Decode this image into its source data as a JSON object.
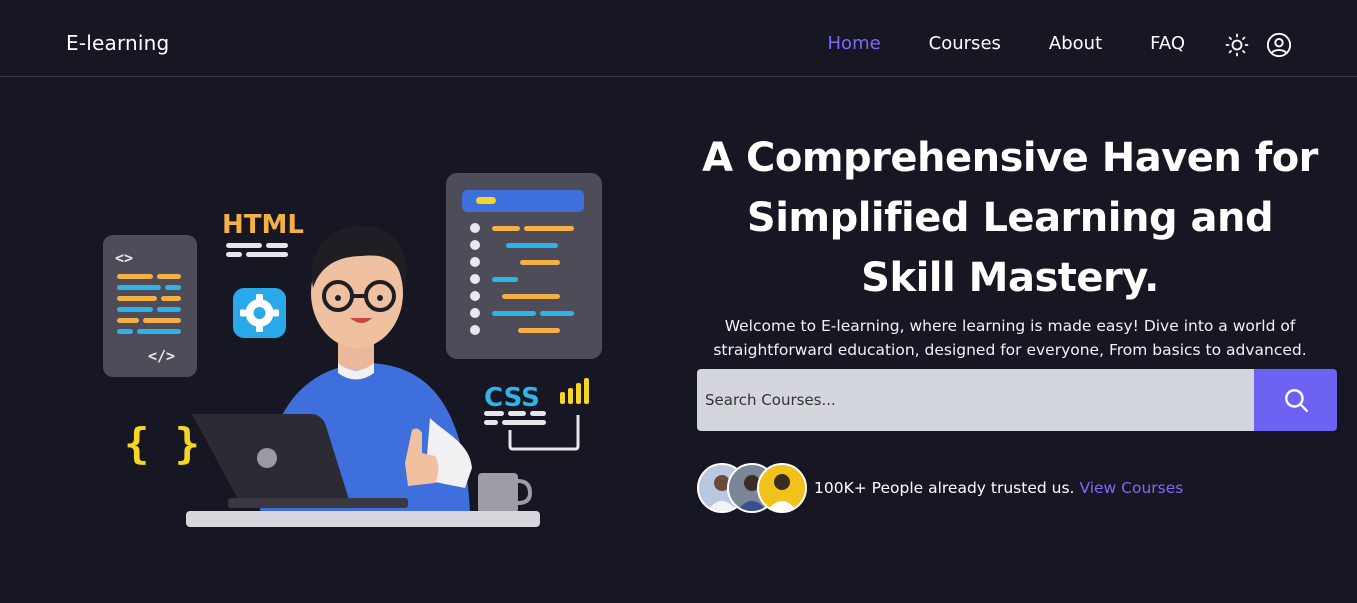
{
  "nav": {
    "brand": "E-learning",
    "links": [
      {
        "label": "Home",
        "active": true
      },
      {
        "label": "Courses",
        "active": false
      },
      {
        "label": "About",
        "active": false
      },
      {
        "label": "FAQ",
        "active": false
      }
    ],
    "icons": [
      "sun-icon",
      "user-circle-icon"
    ]
  },
  "illustration": {
    "html_label": "HTML",
    "css_label": "CSS",
    "code_tag_open": "<>",
    "code_tag_close": "</>",
    "braces": "{ }"
  },
  "hero": {
    "title": "A Comprehensive Haven for Simplified Learning and Skill Mastery.",
    "subtitle": "Welcome to E-learning, where learning is made easy! Dive into a world of straightforward education, designed for everyone, From basics to advanced.",
    "search_placeholder": "Search Courses...",
    "search_icon": "search-icon",
    "trust_text": "100K+ People already trusted us.",
    "trust_link": "View Courses"
  },
  "colors": {
    "background": "#171623",
    "accent": "#6c63f2",
    "link": "#7b6cf6",
    "search_bg": "#d4d6de"
  }
}
